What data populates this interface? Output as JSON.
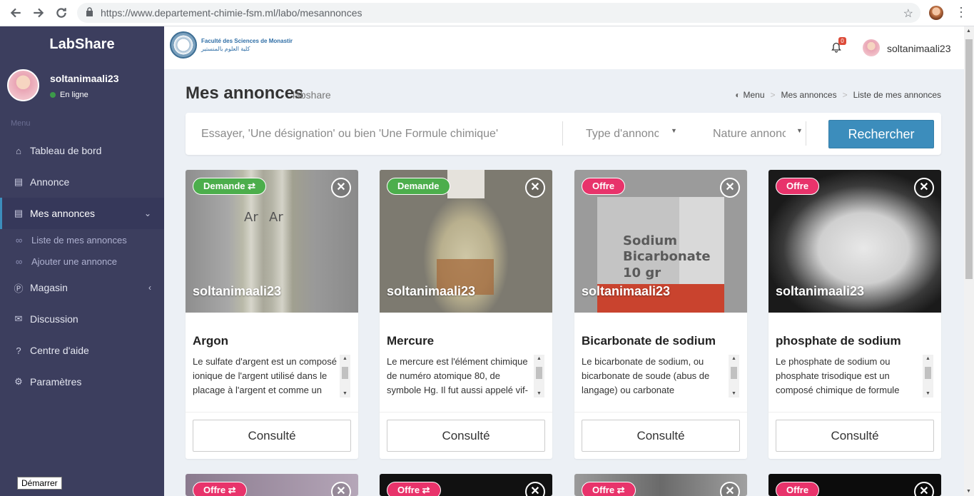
{
  "browser": {
    "url_host": "https://www.departement-chimie-fsm.ml",
    "url_path": "/labo/mesannonces"
  },
  "sidebar": {
    "brand": "LabShare",
    "user": "soltanimaali23",
    "status": "En ligne",
    "menu_header": "Menu",
    "items": [
      {
        "label": "Tableau de bord"
      },
      {
        "label": "Annonce"
      },
      {
        "label": "Mes annonces"
      },
      {
        "label": "Liste de mes annonces"
      },
      {
        "label": "Ajouter une annonce"
      },
      {
        "label": "Magasin"
      },
      {
        "label": "Discussion"
      },
      {
        "label": "Centre d'aide"
      },
      {
        "label": "Paramètres"
      }
    ]
  },
  "header": {
    "logo_fr": "Faculté des Sciences de Monastir",
    "logo_ar": "كلية العلوم بالمنستير",
    "notif_count": "0",
    "user": "soltanimaali23"
  },
  "page": {
    "title": "Mes annonces",
    "subtitle": "labshare",
    "breadcrumb": [
      "Menu",
      "Mes annonces",
      "Liste de mes annonces"
    ]
  },
  "search": {
    "placeholder": "Essayer, 'Une désignation' ou bien 'Une Formule chimique'",
    "type_select": "Type d'annonce",
    "nature_select": "Nature annonce",
    "button": "Rechercher"
  },
  "cards": [
    {
      "badge": "Demande ⇄",
      "owner": "soltanimaali23",
      "title": "Argon",
      "desc": "Le sulfate d'argent est un composé ionique de l'argent utilisé dans le placage à l'argent et comme un",
      "button": "Consulté"
    },
    {
      "badge": "Demande",
      "owner": "soltanimaali23",
      "title": "Mercure",
      "desc": "Le mercure est l'élément chimique de numéro atomique 80, de symbole Hg. Il fut aussi appelé vif-",
      "button": "Consulté"
    },
    {
      "badge": "Offre",
      "owner": "soltanimaali23",
      "title": "Bicarbonate de sodium",
      "desc": "Le bicarbonate de sodium, ou bicarbonate de soude (abus de langage) ou carbonate",
      "button": "Consulté"
    },
    {
      "badge": "Offre",
      "owner": "soltanimaali23",
      "title": "phosphate de sodium",
      "desc": "Le phosphate de sodium ou phosphate trisodique est un composé chimique de formule",
      "button": "Consulté"
    },
    {
      "badge": "Offre ⇄"
    },
    {
      "badge": "Offre ⇄"
    },
    {
      "badge": "Offre ⇄"
    },
    {
      "badge": "Offre"
    }
  ],
  "taskbar": {
    "start": "Démarrer"
  }
}
